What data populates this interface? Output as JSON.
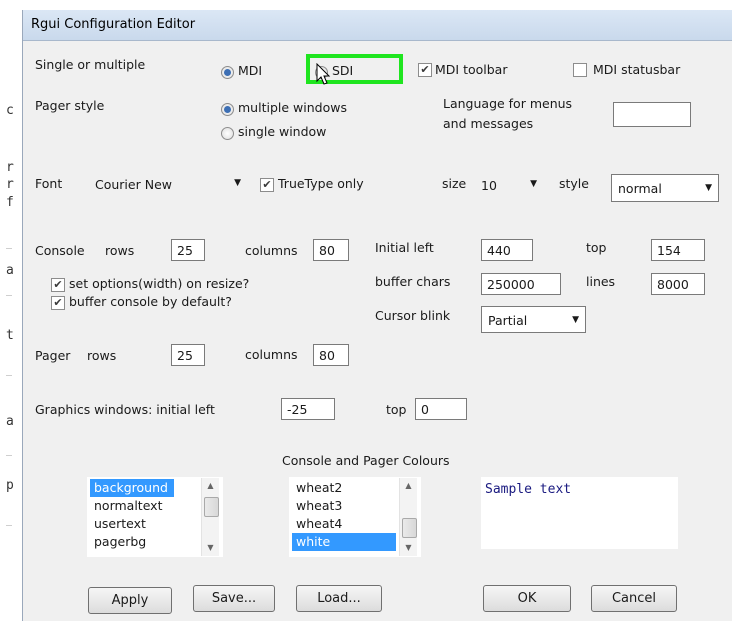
{
  "background_editor": {
    "chars": [
      "c",
      "r",
      "r",
      "f",
      "a",
      "t",
      "a",
      "p"
    ]
  },
  "window": {
    "title": "Rgui Configuration Editor"
  },
  "mdi": {
    "label": "Single or multiple",
    "mdi_option": "MDI",
    "sdi_option": "SDI",
    "selected": "MDI",
    "mdi_toolbar_label": "MDI toolbar",
    "mdi_toolbar_checked": true,
    "mdi_statusbar_label": "MDI statusbar",
    "mdi_statusbar_checked": false
  },
  "pager_style": {
    "label": "Pager style",
    "option_multiple": "multiple windows",
    "option_single": "single window",
    "selected": "multiple windows"
  },
  "language": {
    "label_line1": "Language for menus",
    "label_line2": "and messages",
    "value": ""
  },
  "font": {
    "label": "Font",
    "value": "Courier New",
    "truetype_label": "TrueType only",
    "truetype_checked": true,
    "size_label": "size",
    "size_value": "10",
    "style_label": "style",
    "style_value": "normal"
  },
  "console": {
    "label": "Console",
    "rows_label": "rows",
    "rows_value": "25",
    "columns_label": "columns",
    "columns_value": "80",
    "set_options_label": "set options(width) on resize?",
    "set_options_checked": true,
    "buffer_label": "buffer console by default?",
    "buffer_checked": true
  },
  "initial": {
    "left_label": "Initial left",
    "left_value": "440",
    "top_label": "top",
    "top_value": "154",
    "buffer_chars_label": "buffer chars",
    "buffer_chars_value": "250000",
    "lines_label": "lines",
    "lines_value": "8000",
    "cursor_blink_label": "Cursor blink",
    "cursor_blink_value": "Partial"
  },
  "pager": {
    "label": "Pager",
    "rows_label": "rows",
    "rows_value": "25",
    "columns_label": "columns",
    "columns_value": "80"
  },
  "graphics": {
    "label": "Graphics windows: initial left",
    "left_value": "-25",
    "top_label": "top",
    "top_value": "0"
  },
  "colours": {
    "heading": "Console and Pager Colours",
    "elements": [
      "background",
      "normaltext",
      "usertext",
      "pagerbg"
    ],
    "selected_element": "background",
    "colours": [
      "wheat2",
      "wheat3",
      "wheat4",
      "white"
    ],
    "selected_colour": "white",
    "sample_text": "Sample text"
  },
  "buttons": {
    "apply": "Apply",
    "save": "Save...",
    "load": "Load...",
    "ok": "OK",
    "cancel": "Cancel"
  },
  "colors": {
    "highlight": "#1fe51f",
    "selection": "#3399ff",
    "radio_dot": "#3d6fb4"
  }
}
